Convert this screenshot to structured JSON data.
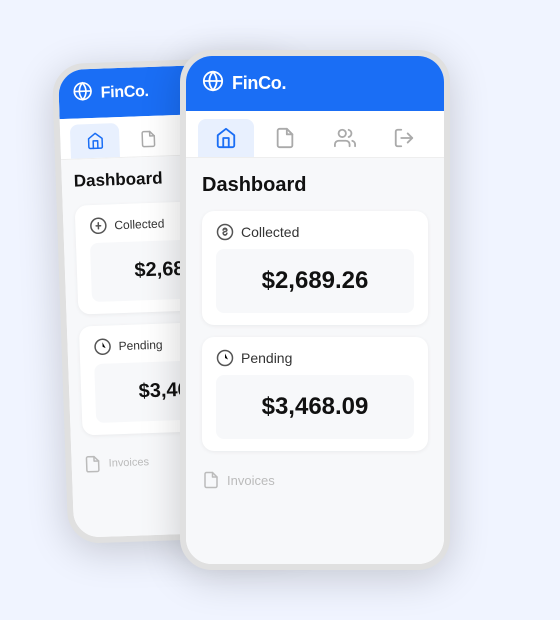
{
  "app": {
    "brand_icon": "🌐",
    "brand_name": "FinCo.",
    "page_title": "Dashboard",
    "nav_tabs": [
      {
        "id": "home",
        "label": "Home",
        "active": true
      },
      {
        "id": "documents",
        "label": "Documents",
        "active": false
      },
      {
        "id": "users",
        "label": "Users",
        "active": false
      },
      {
        "id": "logout",
        "label": "Logout",
        "active": false
      }
    ],
    "cards": [
      {
        "id": "collected",
        "icon": "dollar-circle",
        "label": "Collected",
        "value": "$2,689.26"
      },
      {
        "id": "pending",
        "icon": "clock",
        "label": "Pending",
        "value": "$3,468.09"
      }
    ],
    "invoices_label": "Invoices",
    "colors": {
      "primary": "#1a6ef5",
      "nav_active_bg": "#e8f0fe"
    }
  }
}
